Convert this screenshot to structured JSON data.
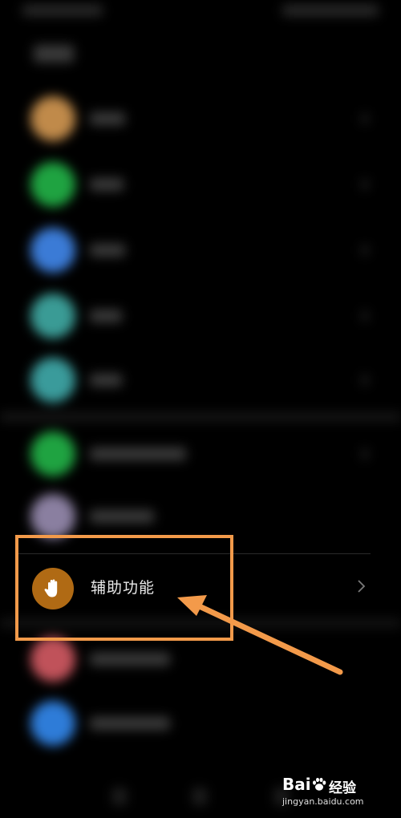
{
  "accessibility_item": {
    "label": "辅助功能",
    "icon": "hand-icon",
    "icon_color": "#b06a14"
  },
  "annotation": {
    "color": "#f39a4a"
  },
  "watermark": {
    "brand": "Bai",
    "suffix": "经验",
    "url": "jingyan.baidu.com"
  },
  "blurred_rows": {
    "icon_colors": [
      "#c08a4a",
      "#1fa341",
      "#3b7bd6",
      "#3a9b95",
      "#3a9b9b",
      "#1fa341",
      "#8a7fa0",
      "#c0525a",
      "#2e7cd8"
    ]
  }
}
